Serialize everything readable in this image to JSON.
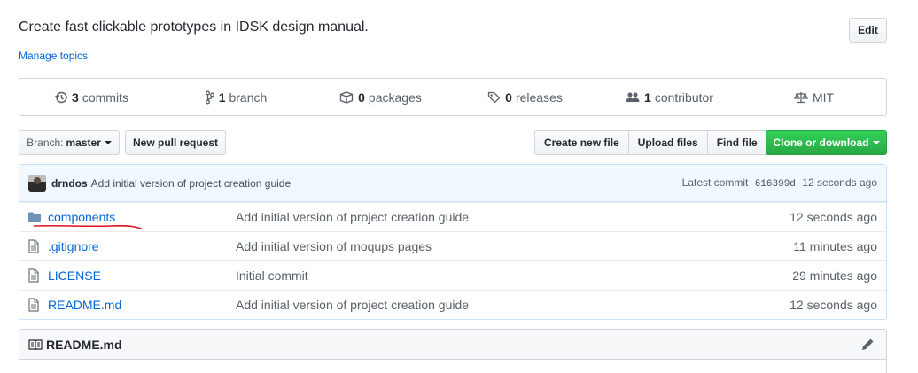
{
  "repo": {
    "description": "Create fast clickable prototypes in IDSK design manual.",
    "manage_topics": "Manage topics",
    "edit_label": "Edit"
  },
  "summary": [
    {
      "icon": "history-icon",
      "count": "3",
      "label": "commits"
    },
    {
      "icon": "git-branch-icon",
      "count": "1",
      "label": "branch"
    },
    {
      "icon": "package-icon",
      "count": "0",
      "label": "packages"
    },
    {
      "icon": "tag-icon",
      "count": "0",
      "label": "releases"
    },
    {
      "icon": "people-icon",
      "count": "1",
      "label": "contributor"
    },
    {
      "icon": "law-icon",
      "count": "",
      "label": "MIT"
    }
  ],
  "toolbar": {
    "branch_prefix": "Branch:",
    "branch_name": "master",
    "new_pull_request": "New pull request",
    "create_new_file": "Create new file",
    "upload_files": "Upload files",
    "find_file": "Find file",
    "clone_or_download": "Clone or download"
  },
  "commit": {
    "author": "drndos",
    "message": "Add initial version of project creation guide",
    "latest_label": "Latest commit",
    "sha": "616399d",
    "time": "12 seconds ago"
  },
  "files": [
    {
      "type": "folder",
      "name": "components",
      "message": "Add initial version of project creation guide",
      "age": "12 seconds ago"
    },
    {
      "type": "file",
      "name": ".gitignore",
      "message": "Add initial version of moqups pages",
      "age": "11 minutes ago"
    },
    {
      "type": "file",
      "name": "LICENSE",
      "message": "Initial commit",
      "age": "29 minutes ago"
    },
    {
      "type": "file",
      "name": "README.md",
      "message": "Add initial version of project creation guide",
      "age": "12 seconds ago"
    }
  ],
  "readme": {
    "title": "README.md"
  },
  "colors": {
    "link": "#0366d6",
    "clone_green": "#28a745",
    "annotation_red": "#e0101c"
  }
}
